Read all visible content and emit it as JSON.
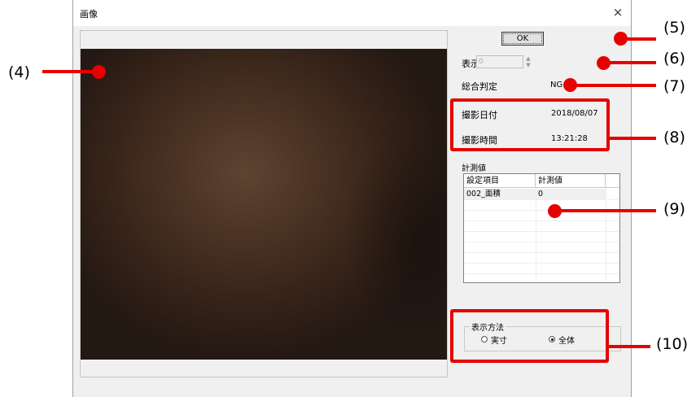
{
  "window": {
    "title": "画像",
    "close_glyph": "×"
  },
  "buttons": {
    "ok": "OK"
  },
  "display_position": {
    "label": "表示位置",
    "value": "0"
  },
  "overall_judgment": {
    "label": "総合判定",
    "value": "NG"
  },
  "capture": {
    "date_label": "撮影日付",
    "date_value": "2018/08/07",
    "time_label": "撮影時間",
    "time_value": "13:21:28"
  },
  "measurements": {
    "section_label": "計測値",
    "columns": [
      "設定項目",
      "計測値"
    ],
    "rows": [
      {
        "item": "002_面積",
        "value": "0"
      }
    ]
  },
  "display_method": {
    "group_label": "表示方法",
    "options": [
      {
        "label": "実寸",
        "selected": false
      },
      {
        "label": "全体",
        "selected": true
      }
    ]
  },
  "callouts": [
    "(4)",
    "(5)",
    "(6)",
    "(7)",
    "(8)",
    "(9)",
    "(10)"
  ],
  "colors": {
    "callout": "#e60000",
    "dialog_bg": "#f0f0f0"
  }
}
